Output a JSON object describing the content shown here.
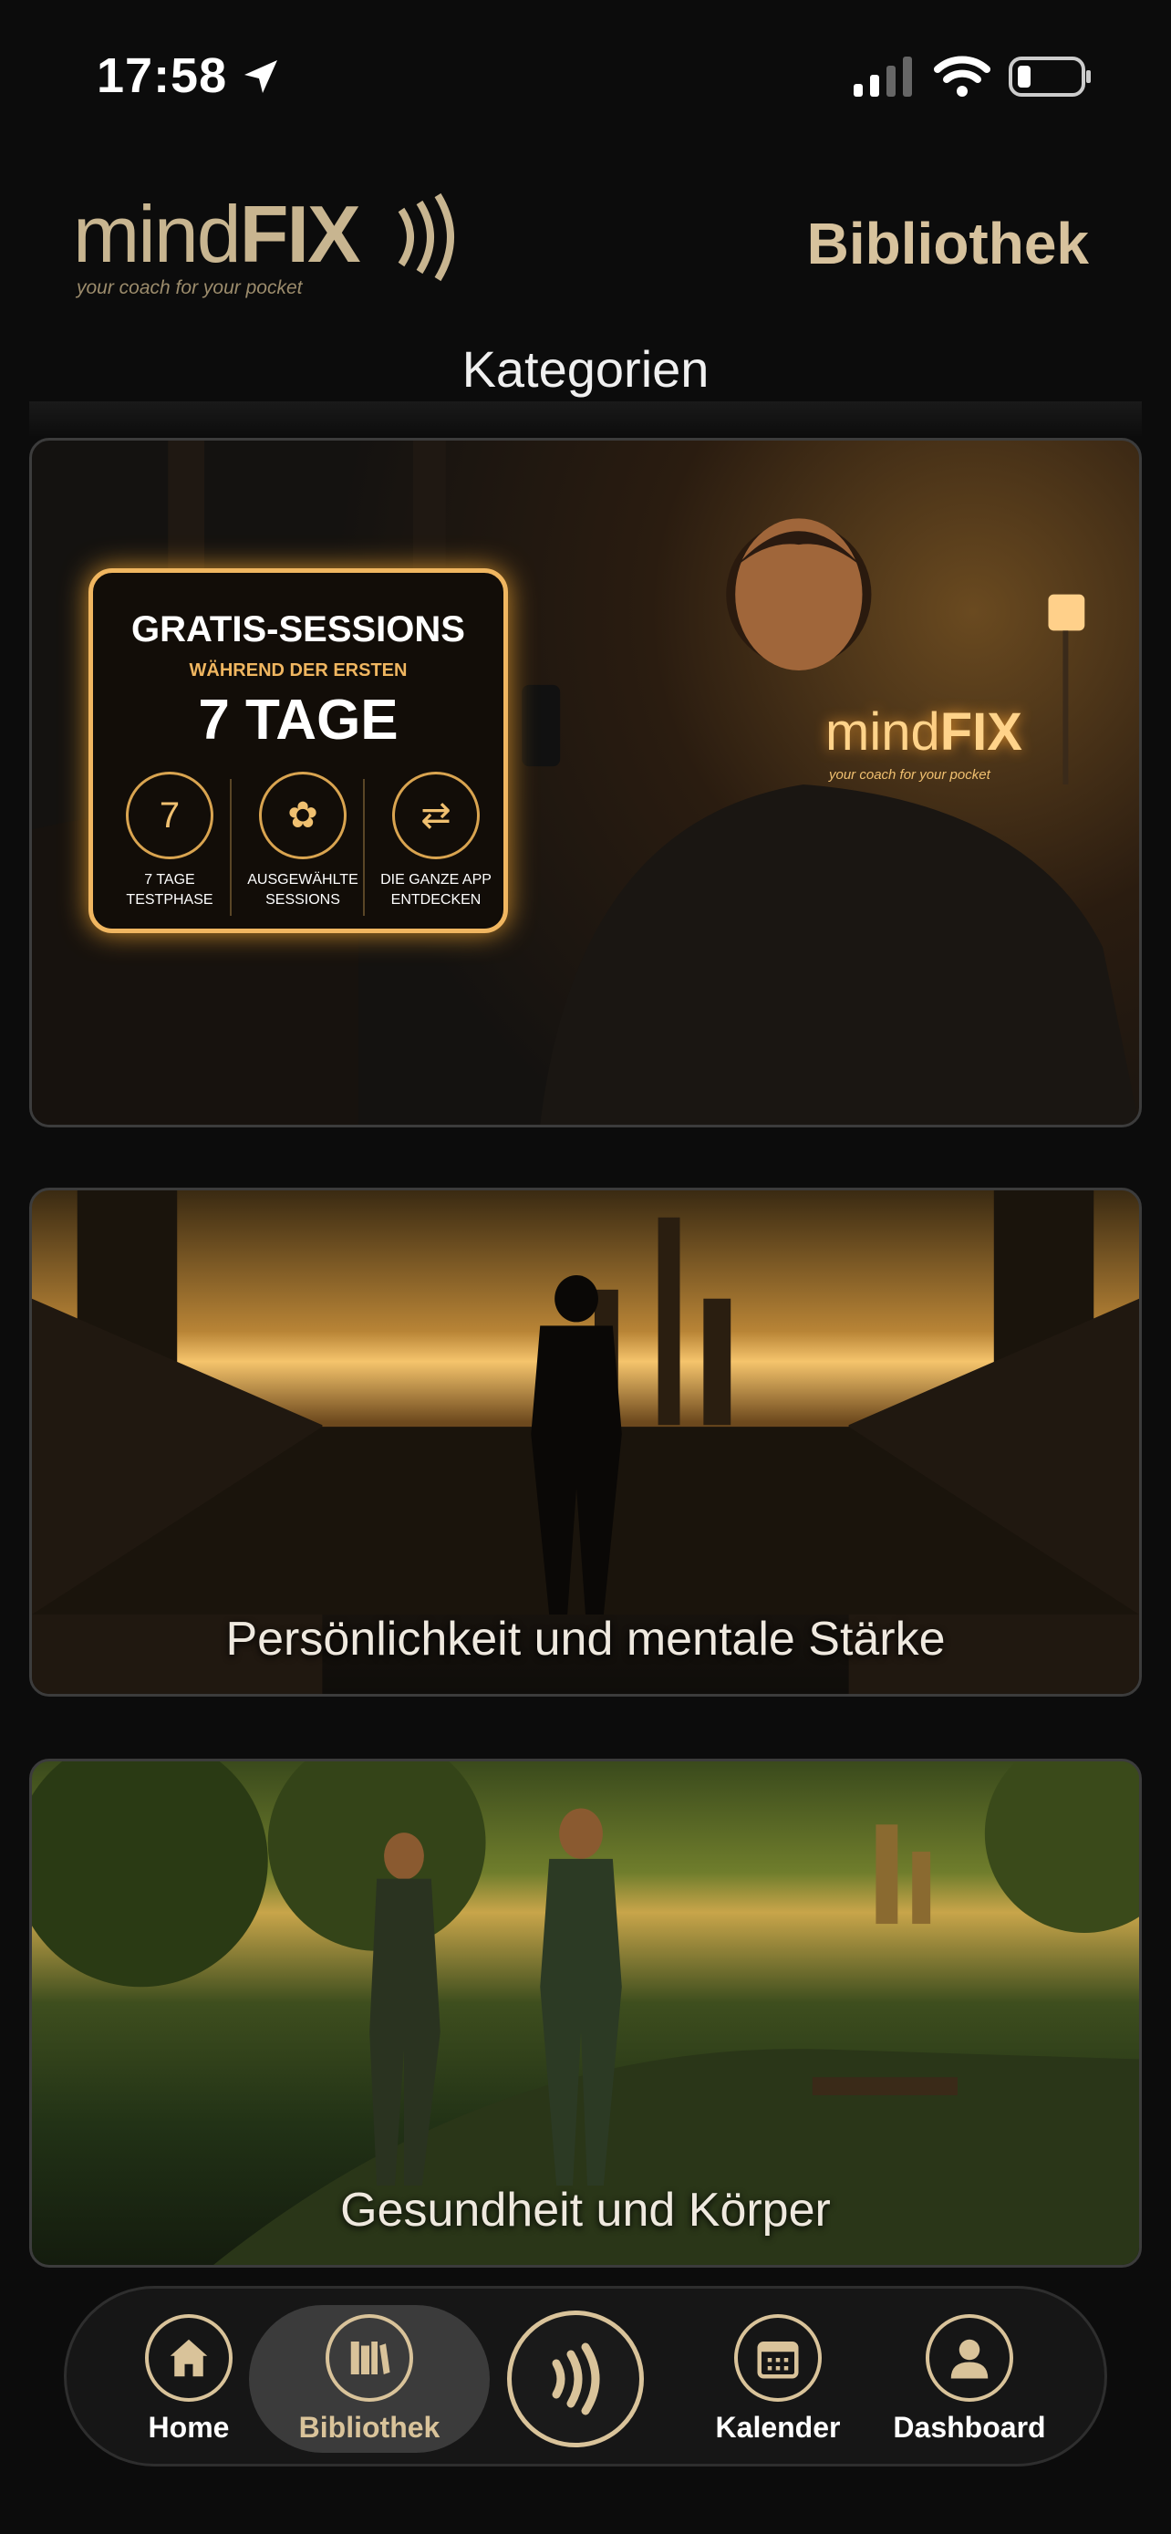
{
  "status": {
    "time": "17:58"
  },
  "header": {
    "logo_light": "mind",
    "logo_bold": "FIX",
    "logo_tagline": "your coach for your pocket",
    "title": "Bibliothek"
  },
  "section": {
    "title": "Kategorien"
  },
  "cards": {
    "promo": {
      "title": "GRATIS-SESSIONS",
      "subtitle": "WÄHREND DER ERSTEN",
      "days": "7 TAGE",
      "features": [
        {
          "icon": "calendar-icon",
          "label": "7 TAGE TESTPHASE",
          "glyph": "7"
        },
        {
          "icon": "lotus-icon",
          "label": "AUSGEWÄHLTE SESSIONS",
          "glyph": "✿"
        },
        {
          "icon": "signpost-icon",
          "label": "DIE GANZE APP ENTDECKEN",
          "glyph": "⇄"
        }
      ],
      "brand_light": "mind",
      "brand_bold": "FIX",
      "brand_tagline": "your coach for your pocket"
    },
    "personality": {
      "label": "Persönlichkeit und mentale Stärke"
    },
    "health": {
      "label": "Gesundheit und Körper"
    }
  },
  "tabbar": {
    "home": "Home",
    "library": "Bibliothek",
    "calendar": "Kalender",
    "dashboard": "Dashboard",
    "accent_color": "#d9c39a"
  }
}
